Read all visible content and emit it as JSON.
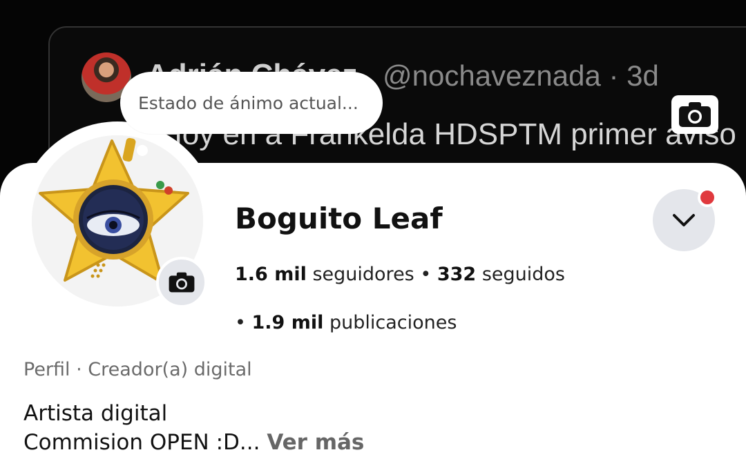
{
  "cover": {
    "topline": "",
    "tweet": {
      "author": "Adrián Chávez",
      "handle": "@nochaveznada · 3d",
      "text": "Hoy en a Frankelda HDSPTM primer aviso"
    }
  },
  "mood": {
    "placeholder": "Estado de ánimo actual..."
  },
  "profile": {
    "name": "Boguito Leaf",
    "followers_count": "1.6 mil",
    "followers_label": "seguidores",
    "following_count": "332",
    "following_label": "seguidos",
    "posts_count": "1.9 mil",
    "posts_label": "publicaciones",
    "category": "Perfil · Creador(a) digital",
    "bio_line1": "Artista digital",
    "bio_line2": "Commision OPEN :D...",
    "see_more": "Ver más"
  },
  "icons": {
    "cover_camera": "camera-icon",
    "avatar_camera": "camera-icon",
    "dropdown": "chevron-down-icon"
  },
  "colors": {
    "notification_dot": "#e0393e",
    "button_bg": "#e4e6eb",
    "star": "#f2c230"
  }
}
